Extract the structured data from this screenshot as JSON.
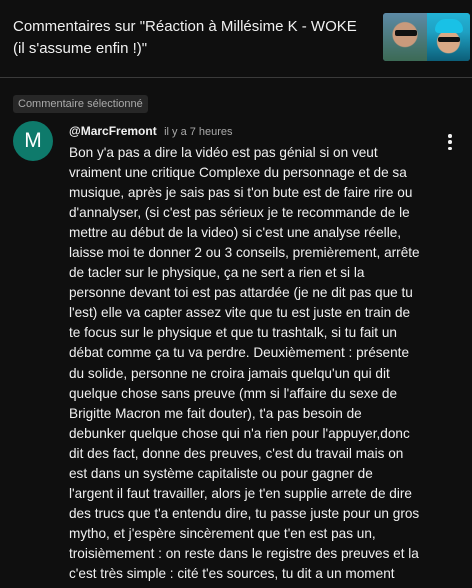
{
  "header": {
    "title": "Commentaires sur \"Réaction à Millésime K - WOKE (il s'assume enfin !)\""
  },
  "badge": "Commentaire sélectionné",
  "comment": {
    "avatar_letter": "M",
    "avatar_color": "#0e7a6b",
    "author": "@MarcFremont",
    "time": "il y a 7 heures",
    "lines": [
      "Bon y'a pas a dire la vidéo est pas génial si on veut",
      "vraiment une critique Complexe du personnage et de sa",
      "musique, après je sais pas si t'on bute est de faire rire ou",
      "d'annalyser, (si c'est pas sérieux je te recommande de le",
      "mettre au début de la video) si c'est une analyse réelle,",
      "laisse moi te donner 2 ou 3 conseils, premièrement, arrête",
      "de tacler sur le physique, ça ne sert a rien et si la",
      "personne devant toi est pas attardée (je ne dit pas que tu",
      "l'est) elle va capter assez vite que tu est juste en train de",
      "te focus sur le physique et que tu trashtalk, si tu fait un",
      "débat comme ça tu va perdre. Deuxièmement : présente",
      "du solide, personne ne croira jamais quelqu'un qui dit",
      "quelque chose sans preuve (mm si l'affaire du sexe de",
      "Brigitte Macron me fait douter), t'a pas besoin de",
      "debunker quelque chose qui n'a rien pour l'appuyer,donc",
      "dit des fact, donne des preuves, c'est du travail mais on",
      "est dans un système capitaliste ou pour gagner de",
      "l'argent il faut travailler, alors je t'en supplie arrete de dire",
      "des trucs que t'a entendu dire, tu passe juste pour un gros",
      "mytho, et j'espère sincèrement que t'en est pas un,",
      "troisièmement : on reste dans le registre des preuves et la",
      "c'est très simple : cité t'es sources, tu dit a un moment"
    ]
  },
  "colors": {
    "background": "#0f0f0f",
    "text_primary": "#f1f1f1",
    "text_secondary": "#aaaaaa",
    "badge_bg": "#272727",
    "divider": "#3a3a3a"
  },
  "icons": {
    "more": "vertical-ellipsis-icon"
  }
}
